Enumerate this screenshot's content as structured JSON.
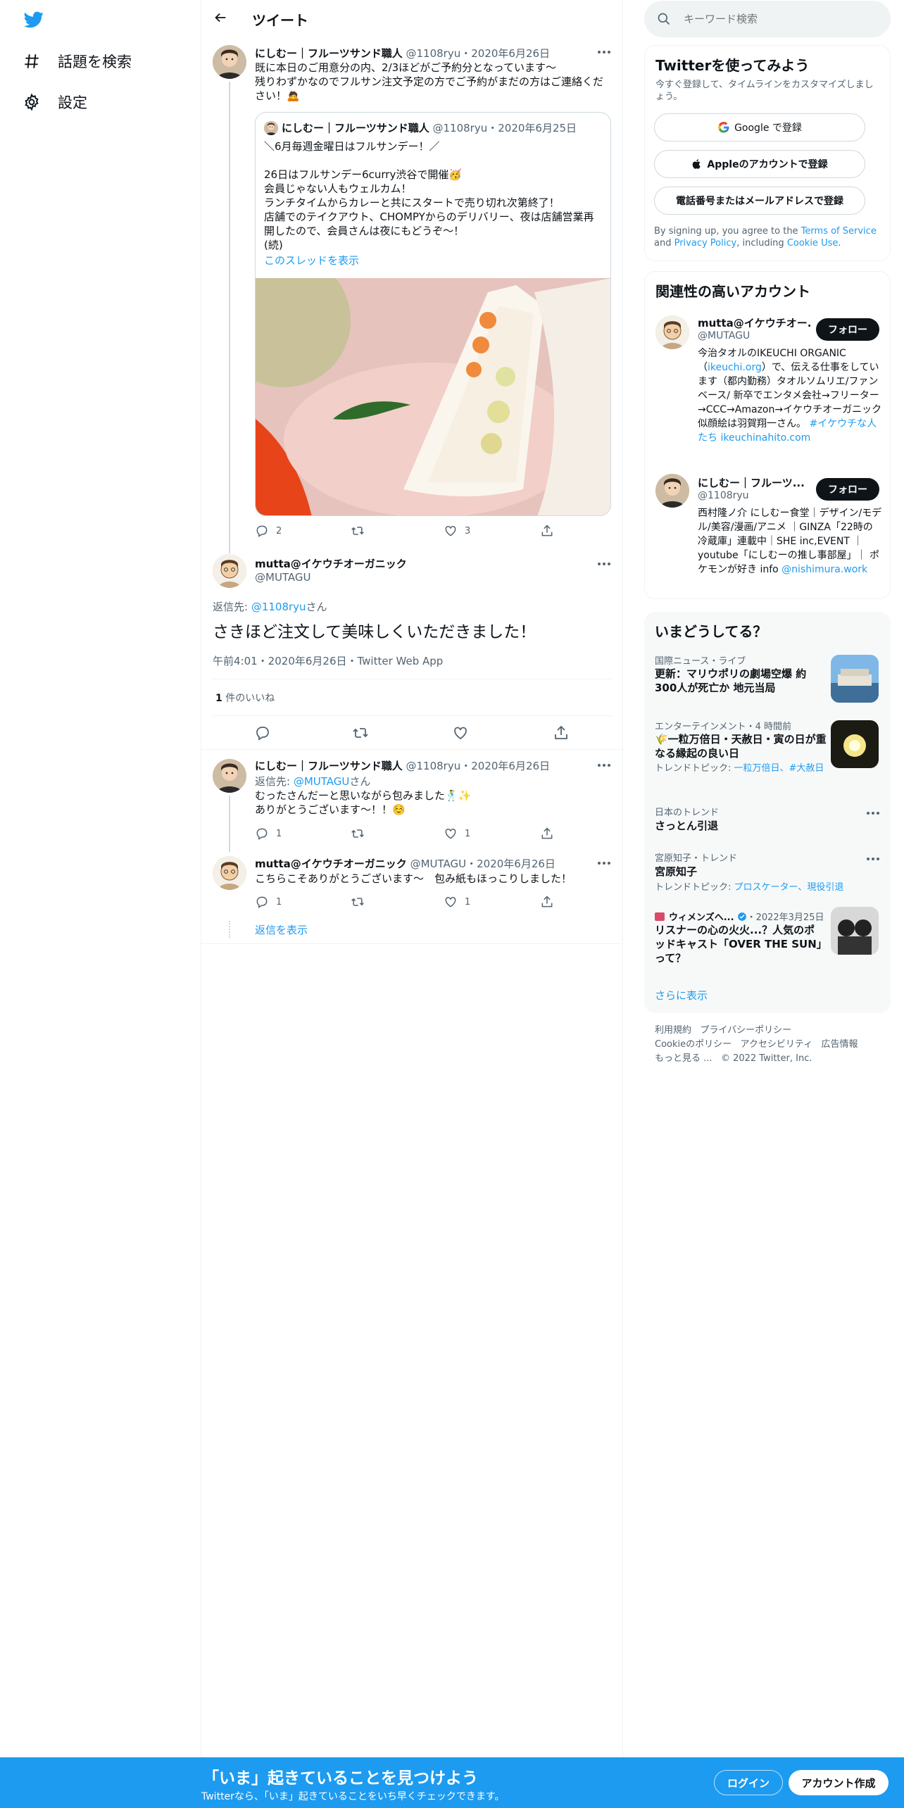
{
  "nav": {
    "explore_label": "話題を検索",
    "settings_label": "設定"
  },
  "header": {
    "title": "ツイート"
  },
  "tweet1": {
    "name": "にしむー｜フルーツサンド職人",
    "handle": "@1108ryu",
    "date": "2020年6月26日",
    "text": "既に本日のご用意分の内、2/3ほどがご予約分となっています〜\n残りわずかなのでフルサン注文予定の方でご予約がまだの方はご連絡ください！🙇",
    "reply_count": "2",
    "like_count": "3"
  },
  "quote": {
    "name": "にしむー｜フルーツサンド職人",
    "handle": "@1108ryu",
    "date": "2020年6月25日",
    "text": "＼6月毎週金曜日はフルサンデー！／\n\n26日はフルサンデー6curry渋谷で開催🥳\n会員じゃない人もウェルカム！\nランチタイムからカレーと共にスタートで売り切れ次第終了！\n店舗でのテイクアウト、CHOMPYからのデリバリー、夜は店舗営業再開したので、会員さんは夜にもどうぞ〜！\n(続)",
    "thread_link": "このスレッドを表示"
  },
  "main_tweet": {
    "name": "mutta@イケウチオーガニック",
    "handle": "@MUTAGU",
    "reply_to_prefix": "返信先: ",
    "reply_to_handle": "@1108ryu",
    "reply_to_suffix": "さん",
    "text": "さきほど注文して美味しくいただきました！",
    "meta": "午前4:01・2020年6月26日・Twitter Web App",
    "likes_count": "1",
    "likes_label": " 件のいいね"
  },
  "reply1": {
    "name": "にしむー｜フルーツサンド職人",
    "handle": "@1108ryu",
    "date": "2020年6月26日",
    "reply_to_prefix": "返信先: ",
    "reply_to_handle": "@MUTAGU",
    "reply_to_suffix": "さん",
    "text": "むったさんだーと思いながら包みました🕺✨\nありがとうございます〜！！☺️",
    "reply_count": "1",
    "like_count": "1"
  },
  "reply2": {
    "name": "mutta@イケウチオーガニック",
    "handle": "@MUTAGU",
    "date": "2020年6月26日",
    "text": "こちらこそありがとうございます〜　包み紙もほっこりしました！",
    "reply_count": "1",
    "like_count": "1"
  },
  "show_replies": "返信を表示",
  "search": {
    "placeholder": "キーワード検索"
  },
  "signup": {
    "title": "Twitterを使ってみよう",
    "subtitle": "今すぐ登録して、タイムラインをカスタマイズしましょう。",
    "google_label": "Google で登録",
    "apple_label": "Appleのアカウントで登録",
    "phone_label": "電話番号またはメールアドレスで登録",
    "terms_prefix": "By signing up, you agree to the ",
    "terms_link": "Terms of Service",
    "terms_and": " and ",
    "privacy_link": "Privacy Policy",
    "terms_including": ", including ",
    "cookie_link": "Cookie Use",
    "terms_end": "."
  },
  "related": {
    "title": "関連性の高いアカウント",
    "accounts": [
      {
        "name": "mutta@イケウチオー...",
        "handle": "@MUTAGU",
        "follow": "フォロー",
        "bio_1": "今治タオルのIKEUCHI ORGANIC（",
        "bio_link1": "ikeuchi.org",
        "bio_2": "）で、伝える仕事をしています（都内勤務）タオルソムリエ/ファンベース/ 新卒でエンタメ会社→フリーター→CCC→Amazon→イケウチオーガニック 似顔絵は羽賀翔一さん。 ",
        "bio_link2": "#イケウチな人たち",
        "bio_link3": "ikeuchinahito.com"
      },
      {
        "name": "にしむー｜フルーツ...",
        "handle": "@1108ryu",
        "follow": "フォロー",
        "bio_1": "西村隆ノ介 にしむー食堂｜デザイン/モデル/美容/漫画/アニメ ｜GINZA「22時の冷蔵庫」連載中｜SHE inc,EVENT ｜ youtube「にしむーの推し事部屋」｜ ポケモンが好き info ",
        "bio_link1": "@nishimura.work"
      }
    ]
  },
  "trends": {
    "title": "いまどうしてる？",
    "items": [
      {
        "meta": "国際ニュース・ライブ",
        "title": "更新：マリウポリの劇場空爆 約300人が死亡か 地元当局"
      },
      {
        "meta": "エンターテインメント・4 時間前",
        "title": "🌾一粒万倍日・天赦日・寅の日が重なる縁起の良い日",
        "topic_prefix": "トレンドトピック: ",
        "topic_links": "一粒万倍日、#大赦日"
      },
      {
        "meta": "日本のトレンド",
        "title": "さっとん引退"
      },
      {
        "meta": "宮原知子・トレンド",
        "title": "宮原知子",
        "topic_prefix": "トレンドトピック: ",
        "topic_links": "プロスケーター、現役引退"
      },
      {
        "source": "ウィメンズへ...",
        "date": "・2022年3月25日",
        "title": "リスナーの心の火火...？人気のポッドキャスト「OVER THE SUN」って？"
      }
    ],
    "show_more": "さらに表示"
  },
  "footer": {
    "terms": "利用規約",
    "privacy": "プライバシーポリシー",
    "cookie": "Cookieのポリシー",
    "accessibility": "アクセシビリティ",
    "ads": "広告情報",
    "more": "もっと見る ...",
    "copyright": "© 2022 Twitter, Inc."
  },
  "bottom_bar": {
    "title": "「いま」起きていることを見つけよう",
    "subtitle": "Twitterなら、「いま」起きていることをいち早くチェックできます。",
    "login": "ログイン",
    "signup": "アカウント作成"
  },
  "colors": {
    "accent": "#1d9bf0",
    "text": "#0f1419",
    "muted": "#536471",
    "border": "#eff3f4"
  }
}
